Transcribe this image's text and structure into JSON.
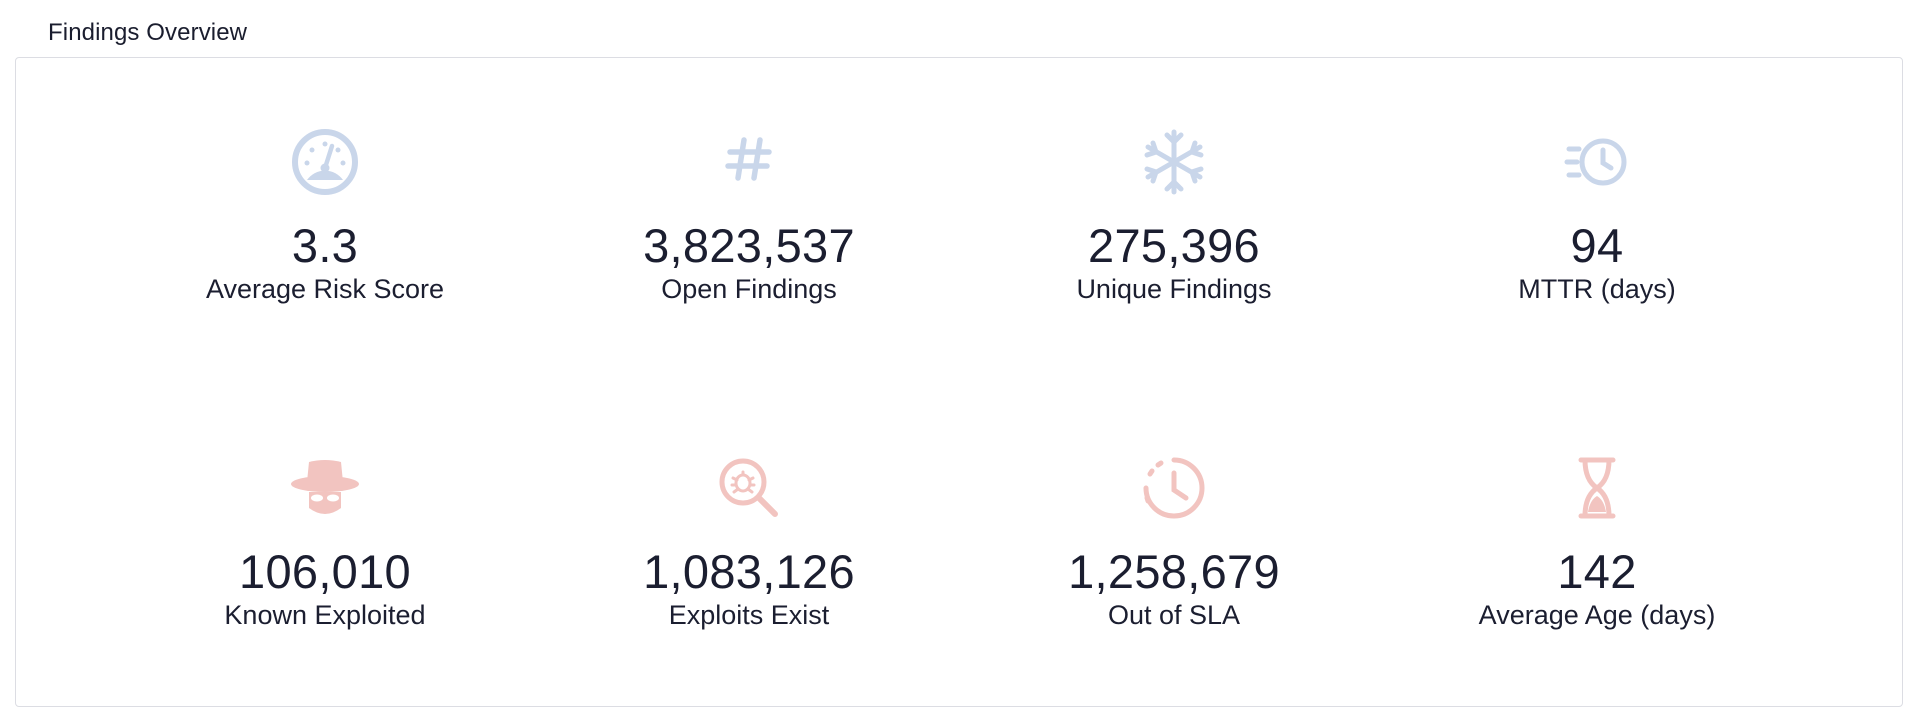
{
  "section": {
    "title": "Findings Overview"
  },
  "colors": {
    "blue_icon": "#c9d6ea",
    "red_icon": "#f2c4c0",
    "text": "#1b1e30",
    "border": "#dcdde3"
  },
  "metrics": [
    {
      "value": "3.3",
      "label": "Average Risk Score",
      "icon": "gauge-icon"
    },
    {
      "value": "3,823,537",
      "label": "Open Findings",
      "icon": "hash-icon"
    },
    {
      "value": "275,396",
      "label": "Unique Findings",
      "icon": "snowflake-icon"
    },
    {
      "value": "94",
      "label": "MTTR (days)",
      "icon": "fast-clock-icon"
    },
    {
      "value": "106,010",
      "label": "Known Exploited",
      "icon": "spy-icon"
    },
    {
      "value": "1,083,126",
      "label": "Exploits Exist",
      "icon": "bug-search-icon"
    },
    {
      "value": "1,258,679",
      "label": "Out of SLA",
      "icon": "dashed-clock-icon"
    },
    {
      "value": "142",
      "label": "Average Age (days)",
      "icon": "hourglass-icon"
    }
  ]
}
